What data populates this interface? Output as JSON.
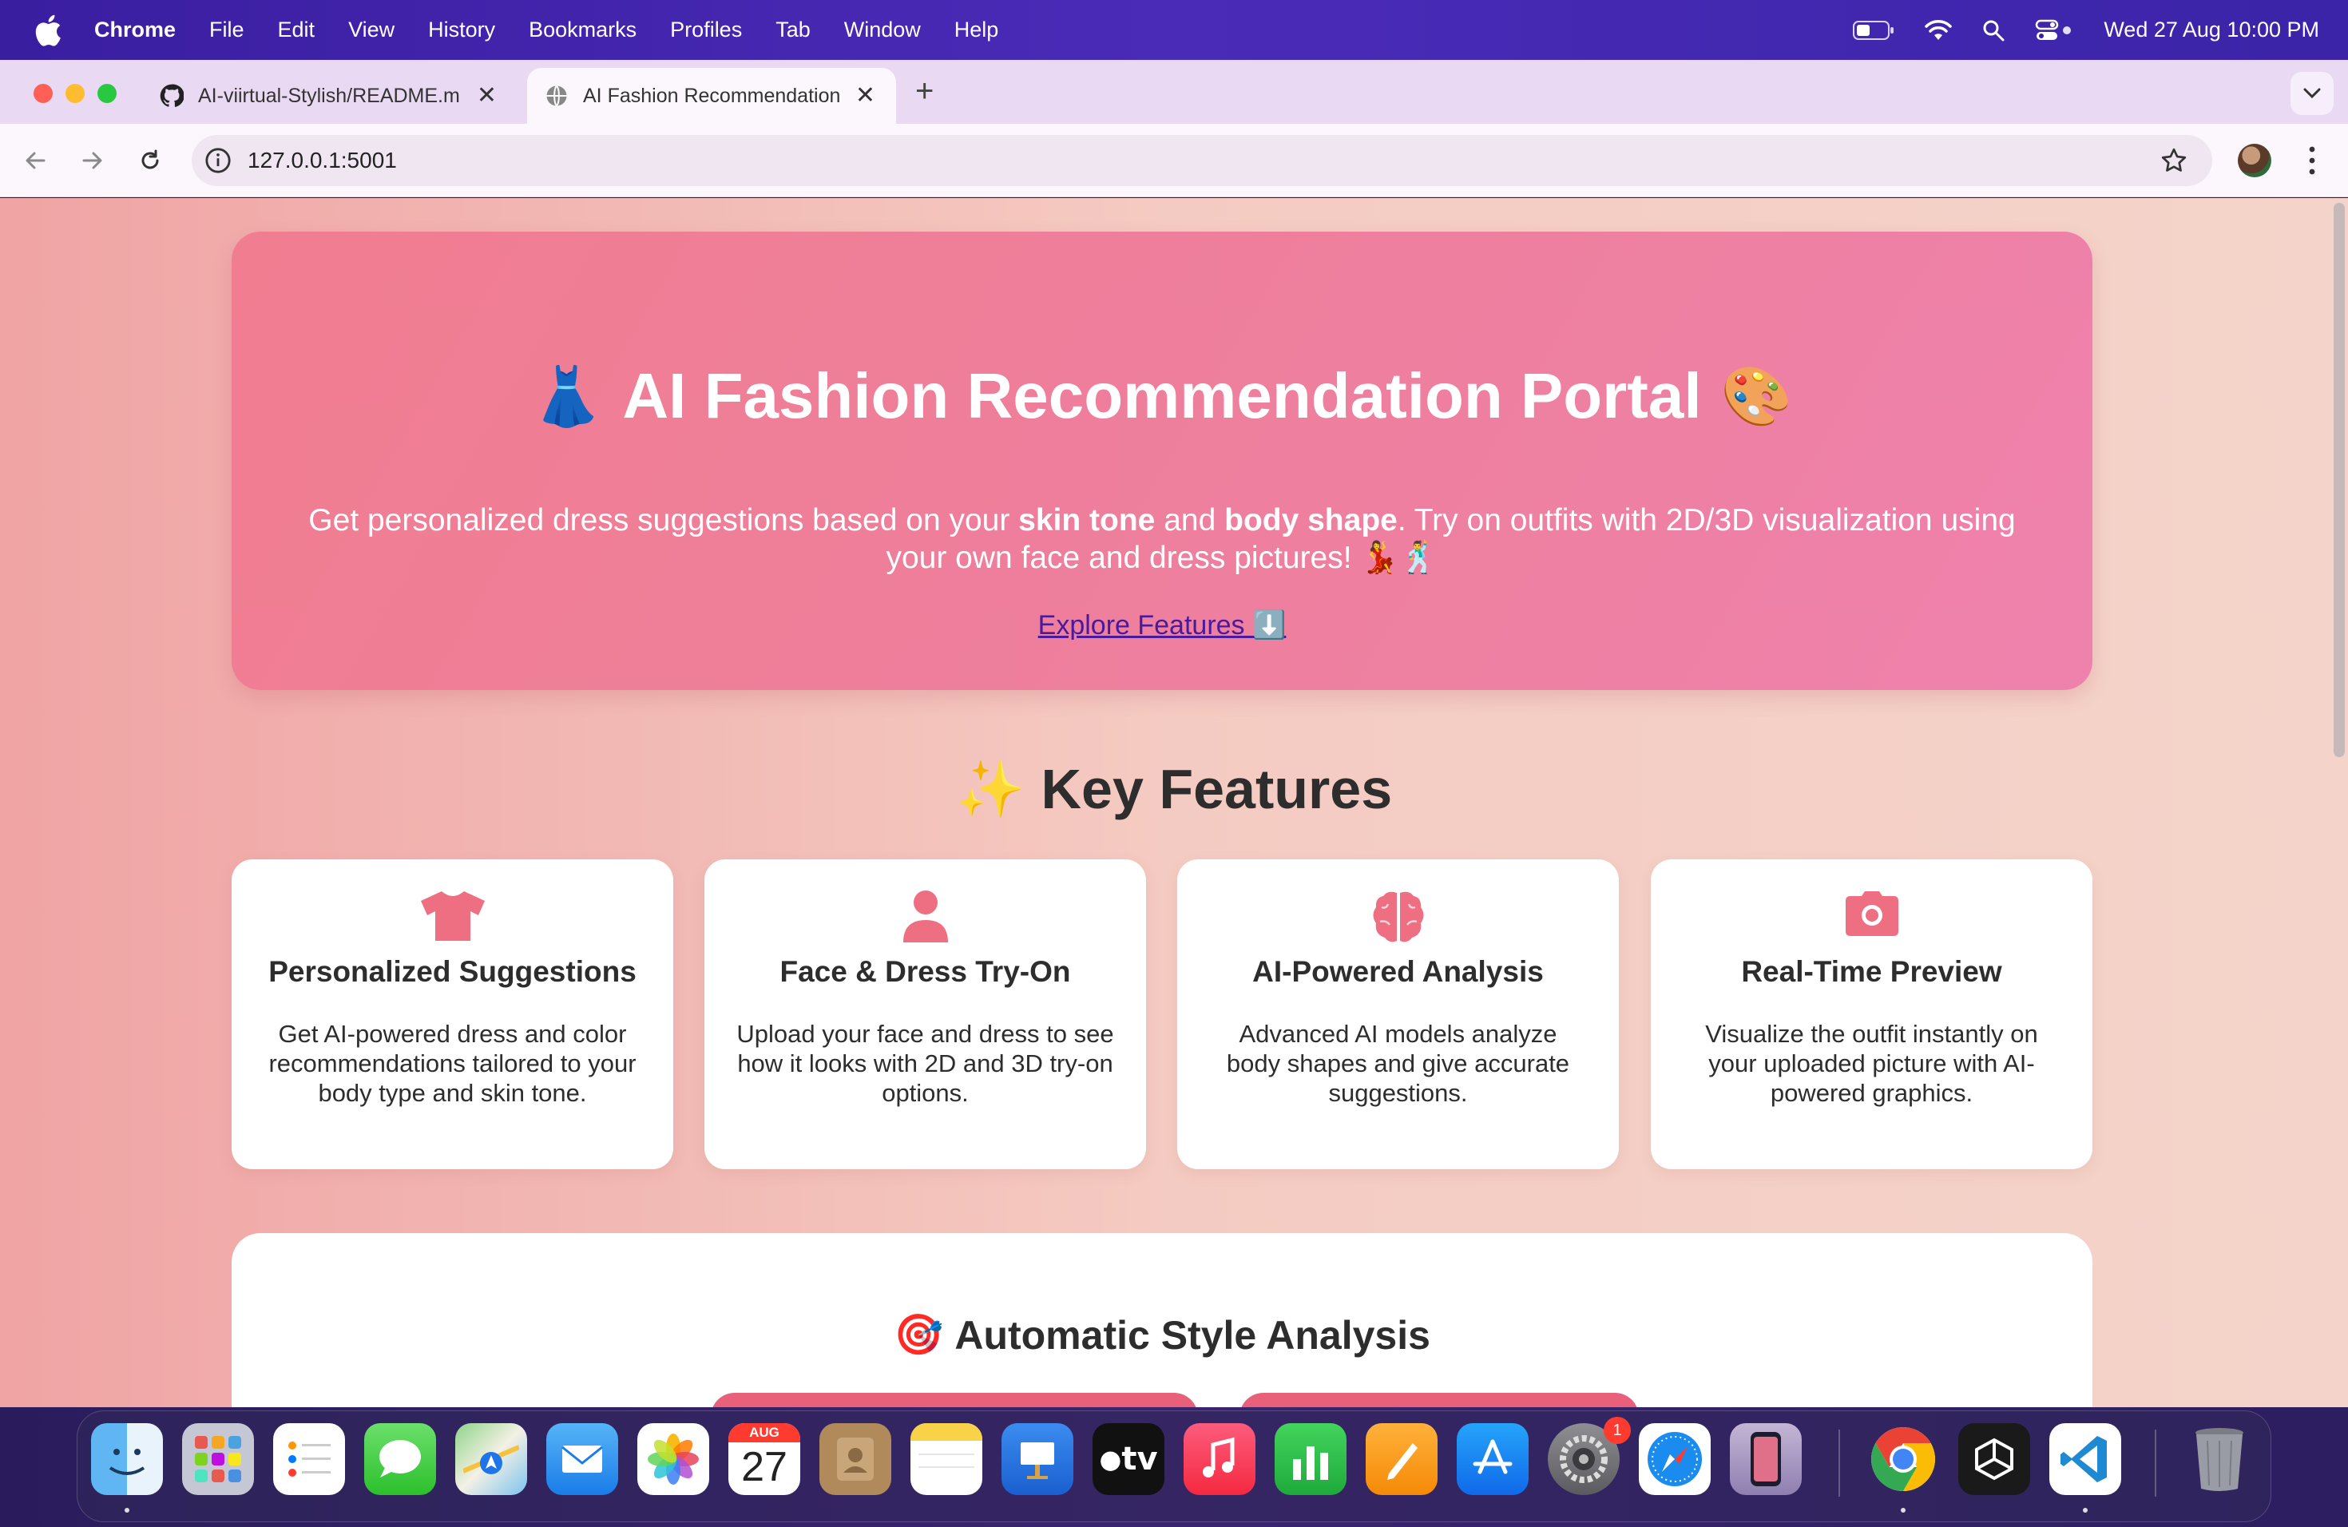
{
  "menubar": {
    "app_name": "Chrome",
    "items": [
      "File",
      "Edit",
      "View",
      "History",
      "Bookmarks",
      "Profiles",
      "Tab",
      "Window",
      "Help"
    ],
    "clock": "Wed 27 Aug  10:00 PM"
  },
  "browser": {
    "tabs": [
      {
        "title": "AI-viirtual-Stylish/README.m",
        "icon": "github-icon"
      },
      {
        "title": "AI Fashion Recommendation",
        "icon": "globe-icon"
      }
    ],
    "url": "127.0.0.1:5001"
  },
  "hero": {
    "title": "AI Fashion Recommendation Portal",
    "title_emoji_left": "👗",
    "title_emoji_right": "🎨",
    "subtitle_part1": "Get personalized dress suggestions based on your ",
    "subtitle_bold1": "skin tone",
    "subtitle_part2": " and ",
    "subtitle_bold2": "body shape",
    "subtitle_part3": ". Try on outfits with 2D/3D visualization using your own face and dress pictures! 💃🕺",
    "cta": "Explore Features ⬇️"
  },
  "features": {
    "title": "✨ Key Features",
    "cards": [
      {
        "icon": "tshirt-icon",
        "title": "Personalized Suggestions",
        "text": "Get AI-powered dress and color recommendations tailored to your body type and skin tone."
      },
      {
        "icon": "user-icon",
        "title": "Face & Dress Try-On",
        "text": "Upload your face and dress to see how it looks with 2D and 3D try-on options."
      },
      {
        "icon": "brain-icon",
        "title": "AI-Powered Analysis",
        "text": "Advanced AI models analyze body shapes and give accurate suggestions."
      },
      {
        "icon": "camera-icon",
        "title": "Real-Time Preview",
        "text": "Visualize the outfit instantly on your uploaded picture with AI-powered graphics."
      }
    ]
  },
  "analysis": {
    "emoji": "🎯",
    "title": "Automatic Style Analysis"
  },
  "dock": {
    "calendar_month": "AUG",
    "calendar_day": "27",
    "tv_label": "tv",
    "settings_badge": "1",
    "apps": [
      "Finder",
      "Launchpad",
      "Reminders",
      "Messages",
      "Maps",
      "Mail",
      "Photos",
      "Calendar",
      "Contacts",
      "Notes",
      "Keynote",
      "Apple TV",
      "Music",
      "Numbers",
      "Pages",
      "App Store",
      "System Settings",
      "Safari",
      "iPhone Mirroring",
      "Google Chrome",
      "Unity",
      "Visual Studio Code",
      "Trash"
    ]
  },
  "colors": {
    "accent": "#e8607a",
    "hero_gradient_start": "#f07d90",
    "hero_gradient_end": "#ef82ad",
    "icon_pink": "#ee6e82"
  }
}
